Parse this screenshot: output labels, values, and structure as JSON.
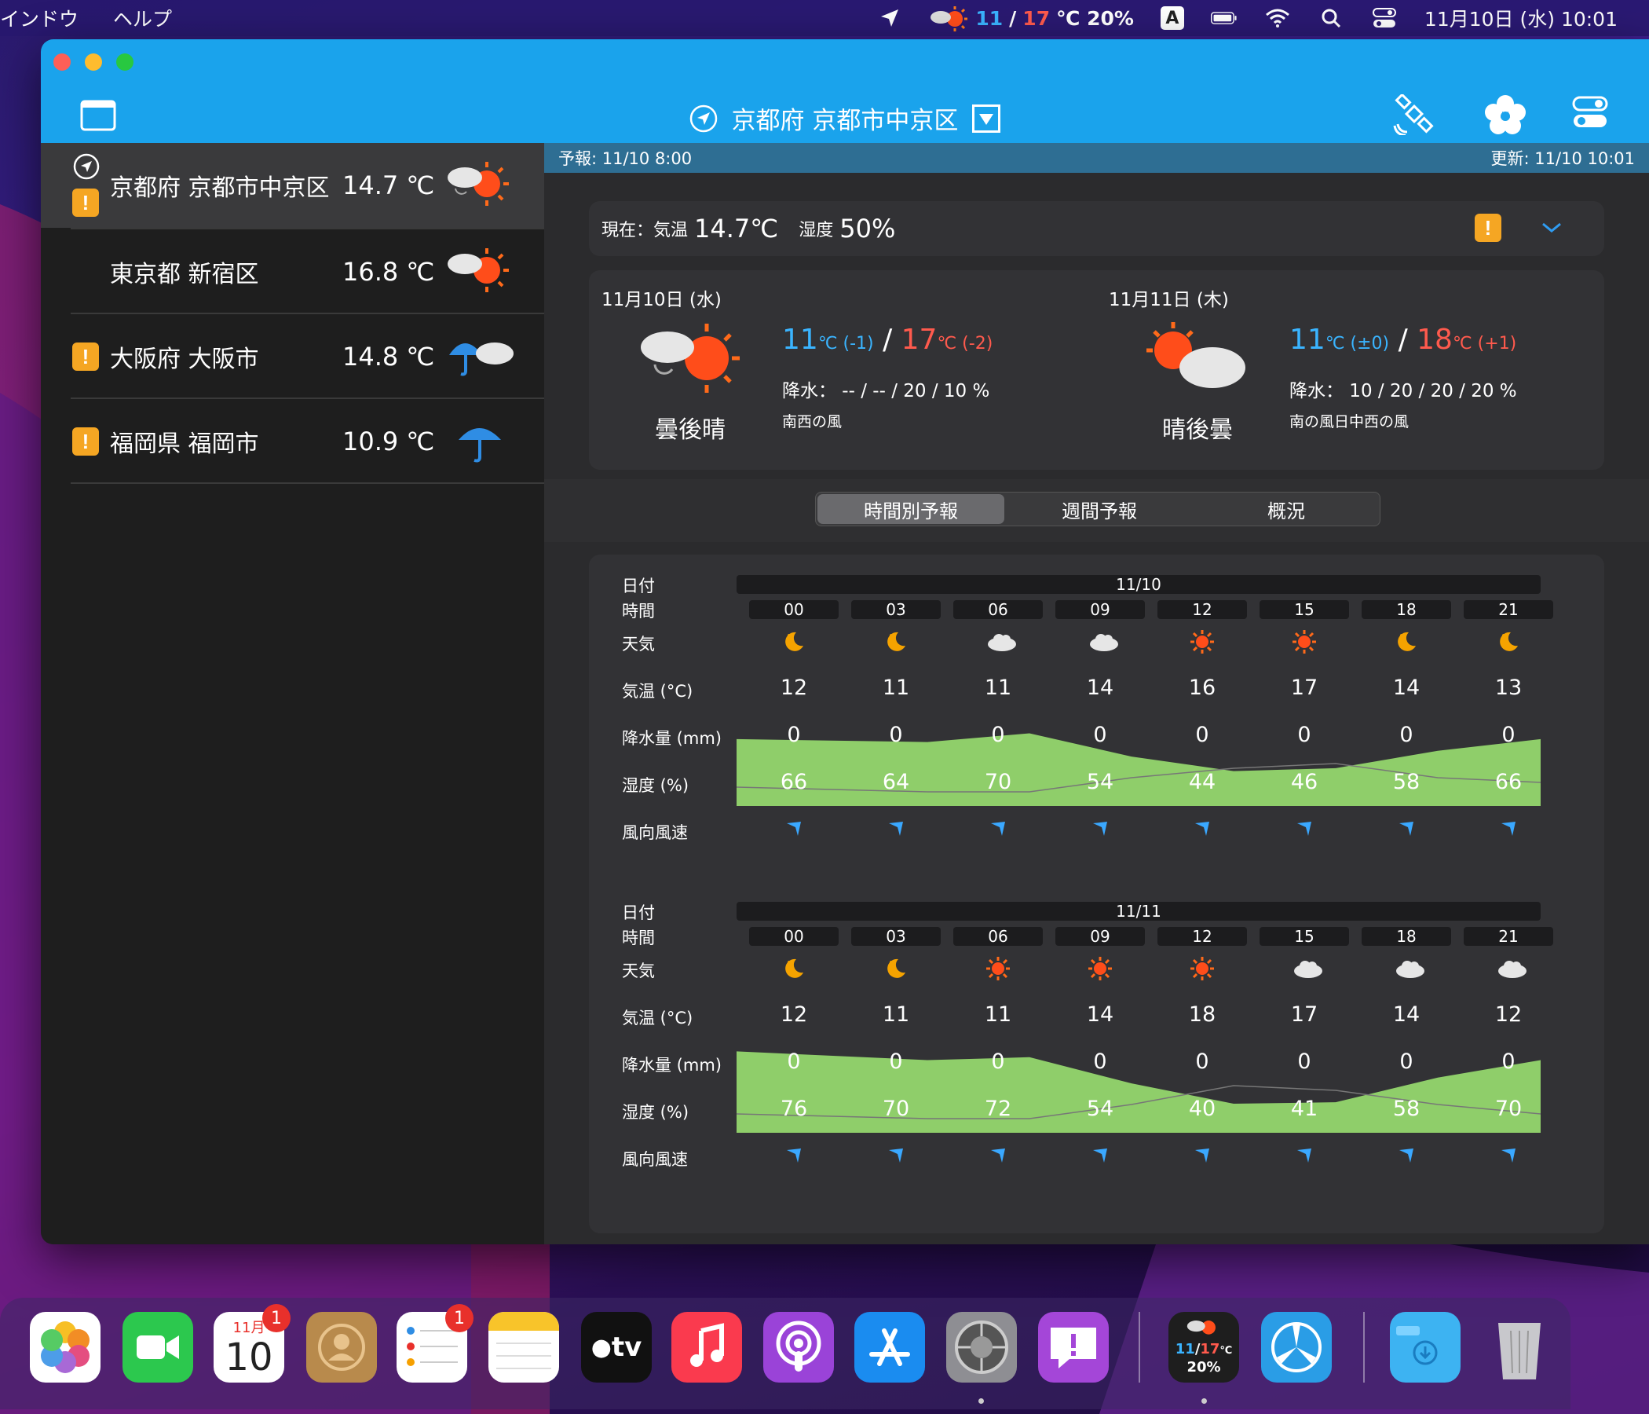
{
  "menubar": {
    "menus": [
      "インドウ",
      "ヘルプ"
    ],
    "weather_low": "11",
    "weather_high": "17",
    "weather_unit_pct": "℃ 20%",
    "input_mode": "A",
    "datetime": "11月10日 (水)  10:01"
  },
  "window": {
    "title": "京都府 京都市中京区",
    "accent": "#1aa3ec"
  },
  "sidebar": {
    "locations": [
      {
        "name": "京都府 京都市中京区",
        "temp": "14.7 ℃"
      },
      {
        "name": "東京都 新宿区",
        "temp": "16.8 ℃"
      },
      {
        "name": "大阪府 大阪市",
        "temp": "14.8 ℃"
      },
      {
        "name": "福岡県 福岡市",
        "temp": "10.9 ℃"
      }
    ]
  },
  "info": {
    "forecast": "予報: 11/10 8:00",
    "updated": "更新: 11/10 10:01"
  },
  "current": {
    "prefix": "現在：気温",
    "temp": "14.7℃",
    "humidity_label": "湿度",
    "humidity": "50%"
  },
  "days": [
    {
      "date": "11月10日 (水)",
      "low": "11",
      "low_diff": "(-1)",
      "high": "17",
      "high_diff": "(-2)",
      "precip": "降水：  -- / -- / 20 / 10 %",
      "wind": "南西の風",
      "condition": "曇後晴"
    },
    {
      "date": "11月11日 (木)",
      "low": "11",
      "low_diff": "(±0)",
      "high": "18",
      "high_diff": "(+1)",
      "precip": "降水：  10 / 20 / 20 / 20 %",
      "wind": "南の風日中西の風",
      "condition": "晴後曇"
    }
  ],
  "tabs": [
    "時間別予報",
    "週間予報",
    "概況"
  ],
  "row_labels": {
    "date": "日付",
    "time": "時間",
    "weather": "天気",
    "temp": "気温 (°C)",
    "precip": "降水量 (mm)",
    "humidity": "湿度 (%)",
    "wind": "風向風速"
  },
  "hourly": [
    {
      "date": "11/10",
      "hours": [
        "00",
        "03",
        "06",
        "09",
        "12",
        "15",
        "18",
        "21"
      ],
      "weather": [
        "moon-icon",
        "moon-icon",
        "cloud-icon",
        "cloud-icon",
        "sun-icon",
        "sun-icon",
        "moon-icon",
        "moon-icon"
      ],
      "temp": [
        "12",
        "11",
        "11",
        "14",
        "16",
        "17",
        "14",
        "13"
      ],
      "precip": [
        "0",
        "0",
        "0",
        "0",
        "0",
        "0",
        "0",
        "0"
      ],
      "humidity": [
        "66",
        "64",
        "70",
        "54",
        "44",
        "46",
        "58",
        "66"
      ]
    },
    {
      "date": "11/11",
      "hours": [
        "00",
        "03",
        "06",
        "09",
        "12",
        "15",
        "18",
        "21"
      ],
      "weather": [
        "moon-icon",
        "moon-icon",
        "sun-icon",
        "sun-icon",
        "sun-icon",
        "cloud-icon",
        "cloud-icon",
        "cloud-icon"
      ],
      "temp": [
        "12",
        "11",
        "11",
        "14",
        "18",
        "17",
        "14",
        "12"
      ],
      "precip": [
        "0",
        "0",
        "0",
        "0",
        "0",
        "0",
        "0",
        "0"
      ],
      "humidity": [
        "76",
        "70",
        "72",
        "54",
        "40",
        "41",
        "58",
        "70"
      ]
    }
  ],
  "dock": {
    "calendar_month": "11月",
    "calendar_day": "10",
    "calendar_badge": "1",
    "reminders_badge": "1",
    "tv_label": "tv",
    "weather_low": "11",
    "weather_high": "17",
    "weather_unit": "℃",
    "weather_pct": "20%"
  }
}
